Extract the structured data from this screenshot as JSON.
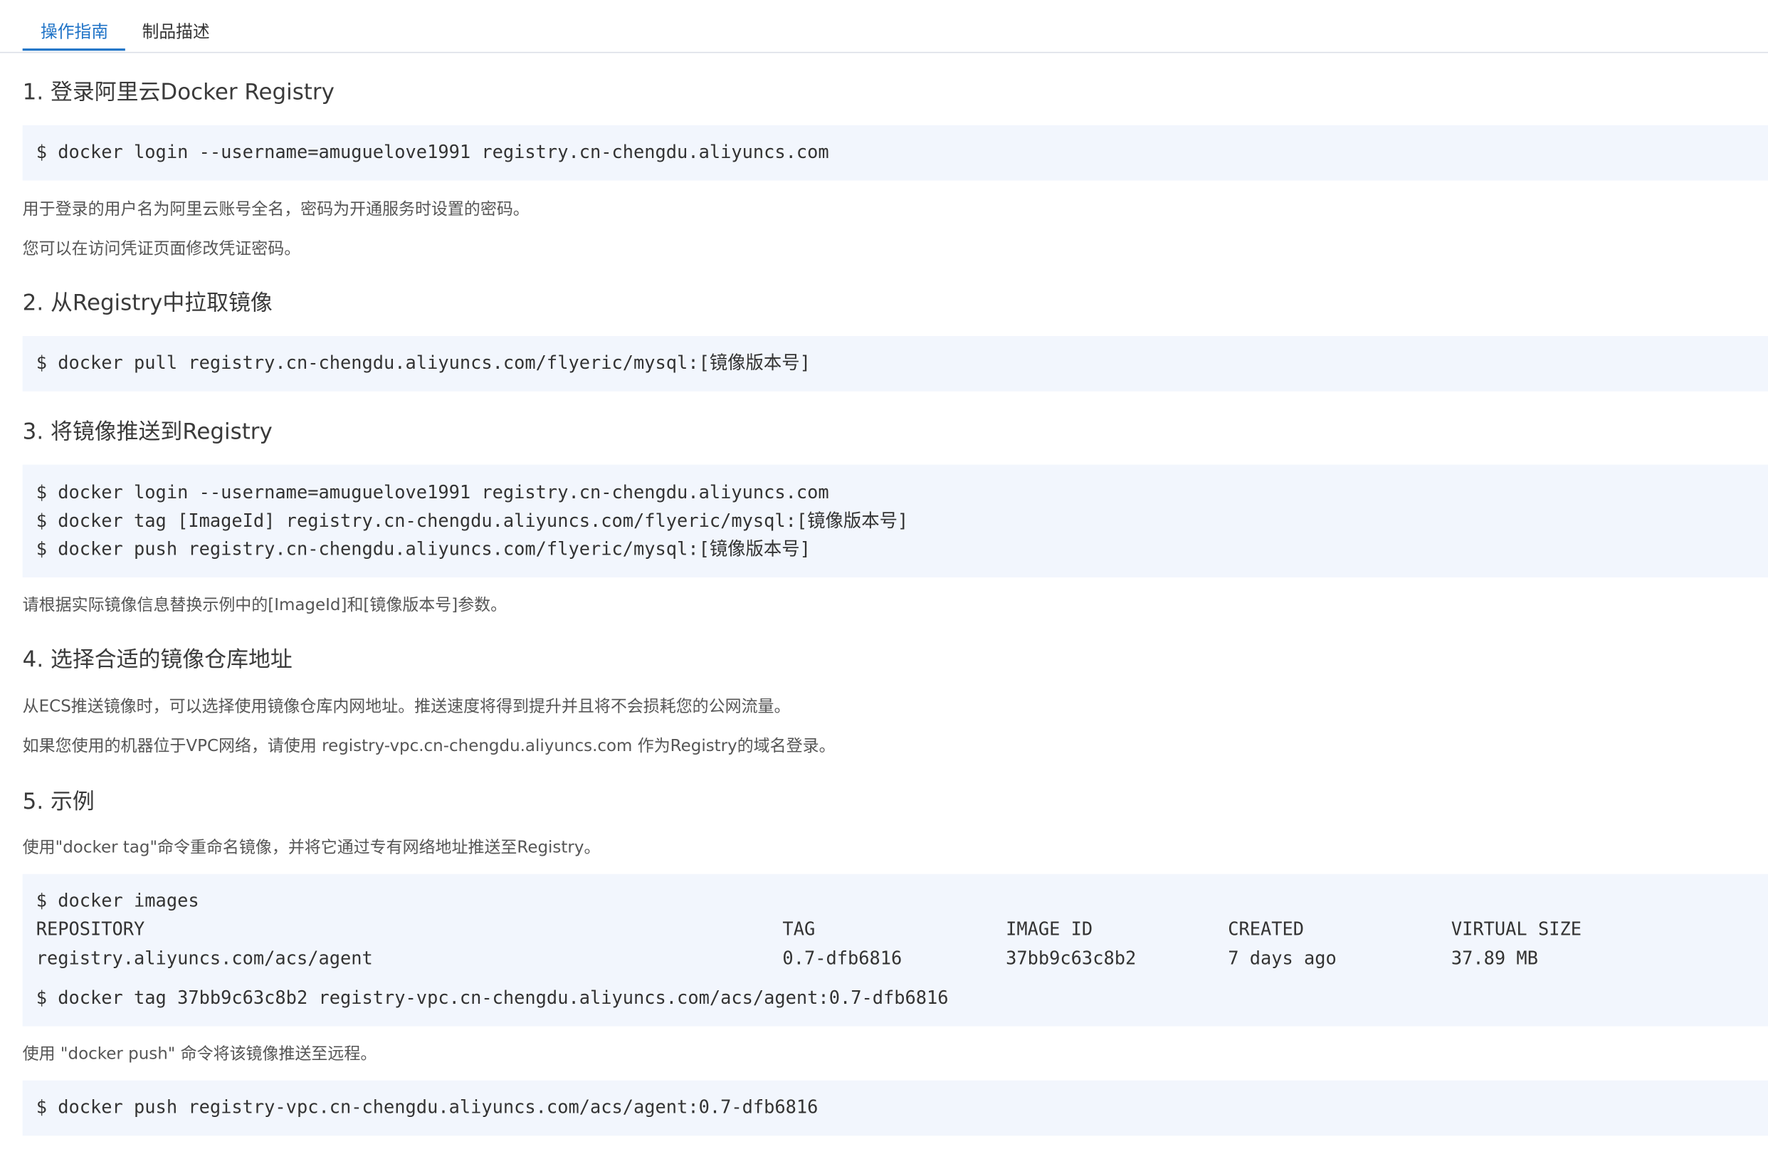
{
  "tabs": {
    "guide": "操作指南",
    "description": "制品描述"
  },
  "sections": {
    "s1": {
      "title": "1. 登录阿里云Docker Registry",
      "code": "$ docker login --username=amuguelove1991 registry.cn-chengdu.aliyuncs.com",
      "note1": "用于登录的用户名为阿里云账号全名，密码为开通服务时设置的密码。",
      "note2": "您可以在访问凭证页面修改凭证密码。"
    },
    "s2": {
      "title": "2. 从Registry中拉取镜像",
      "code": "$ docker pull registry.cn-chengdu.aliyuncs.com/flyeric/mysql:[镜像版本号]"
    },
    "s3": {
      "title": "3. 将镜像推送到Registry",
      "code_lines": [
        "$ docker login --username=amuguelove1991 registry.cn-chengdu.aliyuncs.com",
        "$ docker tag [ImageId] registry.cn-chengdu.aliyuncs.com/flyeric/mysql:[镜像版本号]",
        "$ docker push registry.cn-chengdu.aliyuncs.com/flyeric/mysql:[镜像版本号]"
      ],
      "note": "请根据实际镜像信息替换示例中的[ImageId]和[镜像版本号]参数。"
    },
    "s4": {
      "title": "4. 选择合适的镜像仓库地址",
      "note1": "从ECS推送镜像时，可以选择使用镜像仓库内网地址。推送速度将得到提升并且将不会损耗您的公网流量。",
      "note2": "如果您使用的机器位于VPC网络，请使用 registry-vpc.cn-chengdu.aliyuncs.com 作为Registry的域名登录。"
    },
    "s5": {
      "title": "5. 示例",
      "note1": "使用\"docker tag\"命令重命名镜像，并将它通过专有网络地址推送至Registry。",
      "images_cmd": "$ docker images",
      "table_headers": [
        "REPOSITORY",
        "TAG",
        "IMAGE ID",
        "CREATED",
        "VIRTUAL SIZE"
      ],
      "table_row": [
        "registry.aliyuncs.com/acs/agent",
        "0.7-dfb6816",
        "37bb9c63c8b2",
        "7 days ago",
        "37.89 MB"
      ],
      "tag_cmd": "$ docker tag 37bb9c63c8b2 registry-vpc.cn-chengdu.aliyuncs.com/acs/agent:0.7-dfb6816",
      "note2": "使用 \"docker push\" 命令将该镜像推送至远程。",
      "push_cmd": "$ docker push registry-vpc.cn-chengdu.aliyuncs.com/acs/agent:0.7-dfb6816"
    }
  },
  "colors": {
    "accent": "#1f73c7",
    "code_background": "#f2f6fd"
  }
}
